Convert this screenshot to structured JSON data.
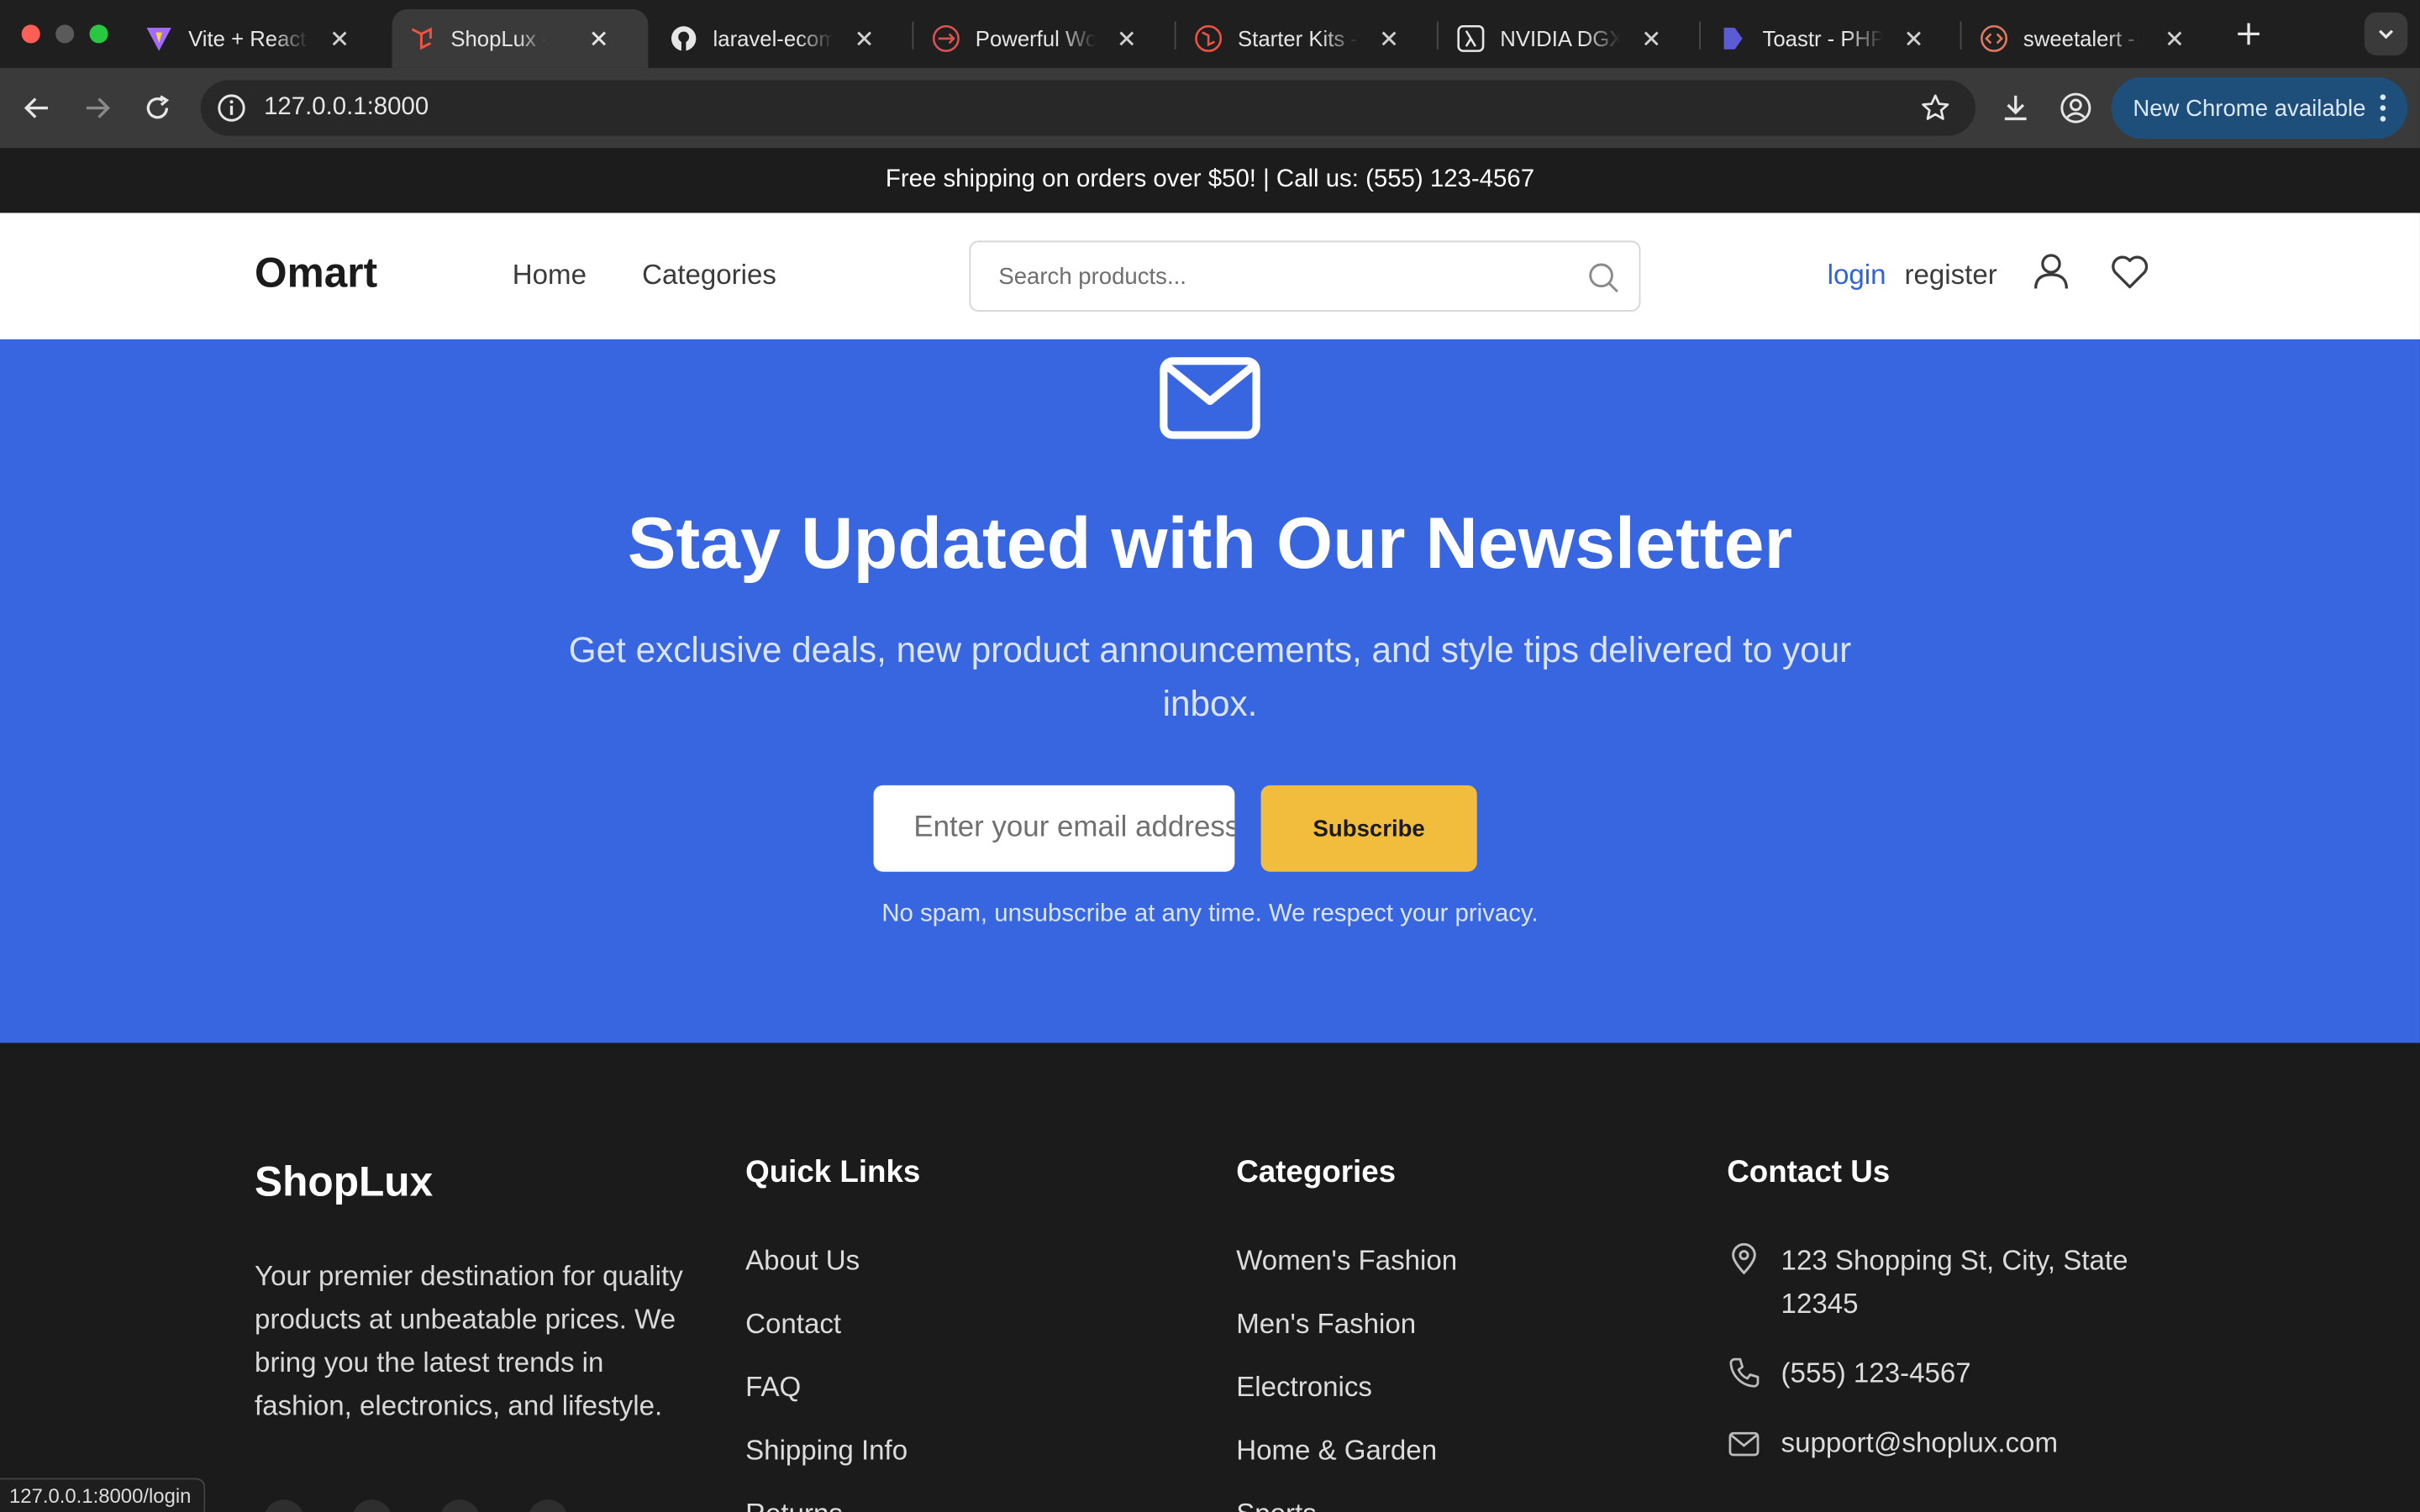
{
  "browser": {
    "tabs": [
      {
        "label": "Vite + React + TS",
        "icon": "vite-icon",
        "active": false
      },
      {
        "label": "ShopLux - Premium",
        "icon": "laravel-icon",
        "active": true
      },
      {
        "label": "laravel-ecommerce",
        "icon": "github-icon",
        "active": false
      },
      {
        "label": "Powerful Workflow",
        "icon": "workflow-icon",
        "active": false
      },
      {
        "label": "Starter Kits - Laravel",
        "icon": "laravel-icon",
        "active": false
      },
      {
        "label": "NVIDIA DGX Systems",
        "icon": "lambda-icon",
        "active": false
      },
      {
        "label": "Toastr - PHPFlasher",
        "icon": "flasher-icon",
        "active": false
      },
      {
        "label": "sweetalert - Library",
        "icon": "code-icon",
        "active": false
      }
    ],
    "url": "127.0.0.1:8000",
    "update_label": "New Chrome available",
    "status_url": "127.0.0.1:8000/login"
  },
  "announcement": "Free shipping on orders over $50! | Call us: (555) 123-4567",
  "header": {
    "logo": "Omart",
    "nav": [
      "Home",
      "Categories"
    ],
    "search_placeholder": "Search products...",
    "login": "login",
    "register": "register"
  },
  "newsletter": {
    "title": "Stay Updated with Our Newsletter",
    "subtitle": "Get exclusive deals, new product announcements, and style tips delivered to your inbox.",
    "email_placeholder": "Enter your email address",
    "button": "Subscribe",
    "privacy": "No spam, unsubscribe at any time. We respect your privacy."
  },
  "footer": {
    "brand": "ShopLux",
    "description": "Your premier destination for quality products at unbeatable prices. We bring you the latest trends in fashion, electronics, and lifestyle.",
    "quick_links_title": "Quick Links",
    "quick_links": [
      "About Us",
      "Contact",
      "FAQ",
      "Shipping Info",
      "Returns"
    ],
    "categories_title": "Categories",
    "categories": [
      "Women's Fashion",
      "Men's Fashion",
      "Electronics",
      "Home & Garden",
      "Sports"
    ],
    "contact_title": "Contact Us",
    "address": "123 Shopping St, City, State 12345",
    "phone": "(555) 123-4567",
    "email": "support@shoplux.com"
  },
  "colors": {
    "accent_blue": "#3766e0",
    "subscribe_yellow": "#f2bd3c",
    "login_link": "#2f63d6",
    "footer_bg": "#1b1b1b"
  }
}
